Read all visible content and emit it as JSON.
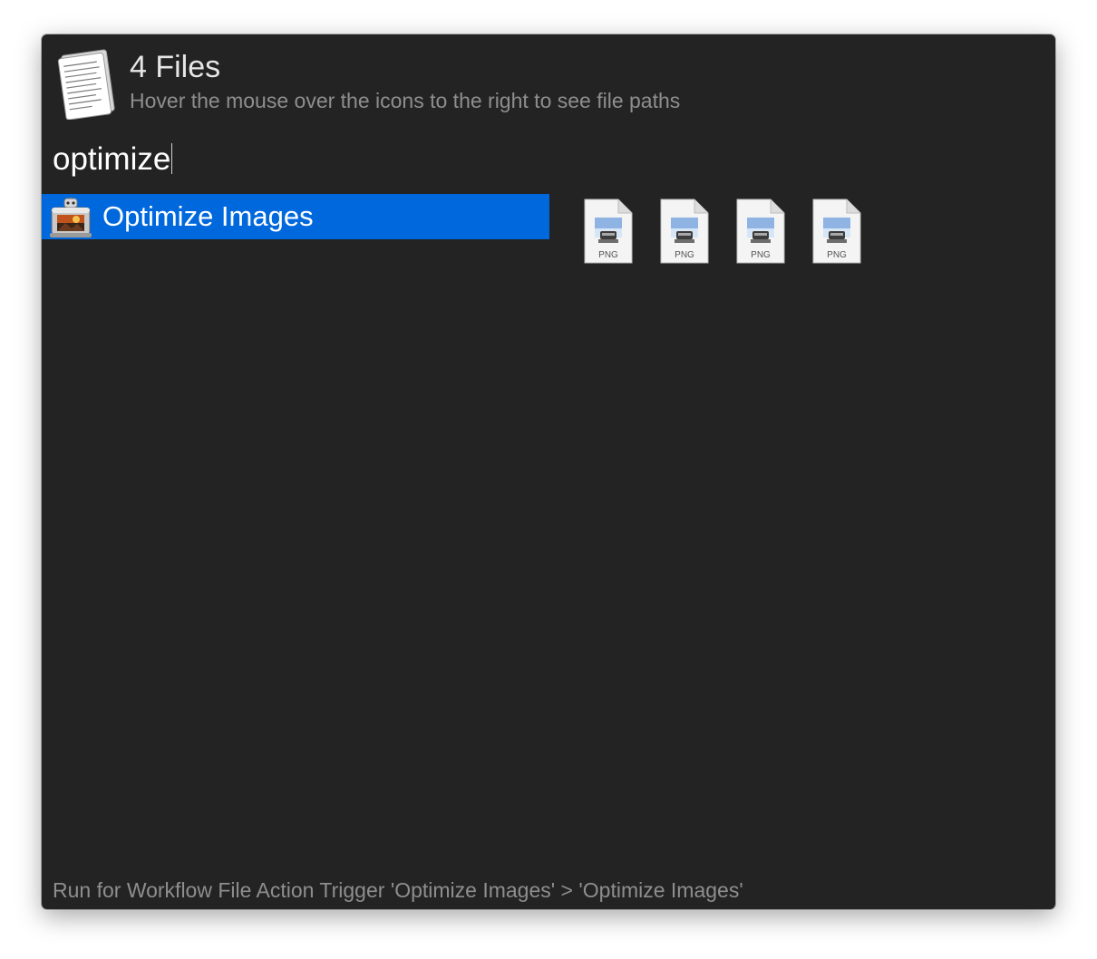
{
  "header": {
    "icon": "document-stack-icon",
    "title": "4 Files",
    "subtitle": "Hover the mouse over the icons to the right to see file paths"
  },
  "query": {
    "value": "optimize"
  },
  "results": [
    {
      "label": "Optimize Images",
      "icon": "image-optimizer-app-icon",
      "selected": true,
      "selected_color": "#0068dd"
    }
  ],
  "files": [
    {
      "type_label": "PNG",
      "icon": "png-file-icon"
    },
    {
      "type_label": "PNG",
      "icon": "png-file-icon"
    },
    {
      "type_label": "PNG",
      "icon": "png-file-icon"
    },
    {
      "type_label": "PNG",
      "icon": "png-file-icon"
    }
  ],
  "footer": {
    "text": "Run for Workflow File Action Trigger 'Optimize Images' > 'Optimize Images'"
  }
}
